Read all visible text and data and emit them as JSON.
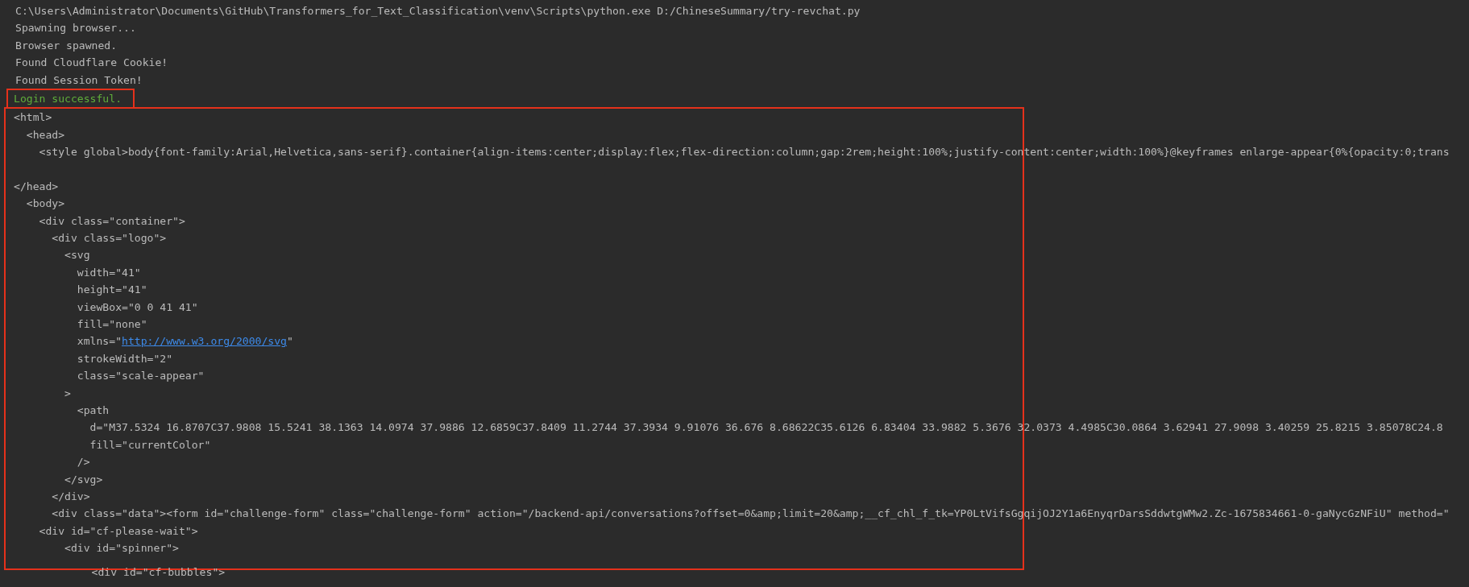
{
  "console": {
    "blocks": [
      {
        "kind": "plain",
        "lines": [
          {
            "kind": "plain",
            "text": "C:\\Users\\Administrator\\Documents\\GitHub\\Transformers_for_Text_Classification\\venv\\Scripts\\python.exe D:/ChineseSummary/try-revchat.py"
          },
          {
            "kind": "plain",
            "text": "Spawning browser..."
          },
          {
            "kind": "plain",
            "text": "Browser spawned."
          },
          {
            "kind": "plain",
            "text": "Found Cloudflare Cookie!"
          },
          {
            "kind": "plain",
            "text": "Found Session Token!"
          }
        ]
      },
      {
        "kind": "narrow",
        "lines": [
          {
            "kind": "success",
            "text": "Login successful."
          }
        ]
      },
      {
        "kind": "wide",
        "lines": [
          {
            "kind": "plain",
            "text": "<html>"
          },
          {
            "kind": "plain",
            "text": "  <head>"
          },
          {
            "kind": "plain",
            "text": "    <style global>body{font-family:Arial,Helvetica,sans-serif}.container{align-items:center;display:flex;flex-direction:column;gap:2rem;height:100%;justify-content:center;width:100%}@keyframes enlarge-appear{0%{opacity:0;trans"
          },
          {
            "kind": "blank"
          },
          {
            "kind": "plain",
            "text": "</head>"
          },
          {
            "kind": "plain",
            "text": "  <body>"
          },
          {
            "kind": "plain",
            "text": "    <div class=\"container\">"
          },
          {
            "kind": "plain",
            "text": "      <div class=\"logo\">"
          },
          {
            "kind": "plain",
            "text": "        <svg"
          },
          {
            "kind": "plain",
            "text": "          width=\"41\""
          },
          {
            "kind": "plain",
            "text": "          height=\"41\""
          },
          {
            "kind": "plain",
            "text": "          viewBox=\"0 0 41 41\""
          },
          {
            "kind": "plain",
            "text": "          fill=\"none\""
          },
          {
            "kind": "link",
            "before": "          xmlns=\"",
            "link": "http://www.w3.org/2000/svg",
            "after": "\""
          },
          {
            "kind": "plain",
            "text": "          strokeWidth=\"2\""
          },
          {
            "kind": "plain",
            "text": "          class=\"scale-appear\""
          },
          {
            "kind": "plain",
            "text": "        >"
          },
          {
            "kind": "plain",
            "text": "          <path"
          },
          {
            "kind": "plain",
            "text": "            d=\"M37.5324 16.8707C37.9808 15.5241 38.1363 14.0974 37.9886 12.6859C37.8409 11.2744 37.3934 9.91076 36.676 8.68622C35.6126 6.83404 33.9882 5.3676 32.0373 4.4985C30.0864 3.62941 27.9098 3.40259 25.8215 3.85078C24.8"
          },
          {
            "kind": "plain",
            "text": "            fill=\"currentColor\""
          },
          {
            "kind": "plain",
            "text": "          />"
          },
          {
            "kind": "plain",
            "text": "        </svg>"
          },
          {
            "kind": "plain",
            "text": "      </div>"
          },
          {
            "kind": "plain",
            "text": "      <div class=\"data\"><form id=\"challenge-form\" class=\"challenge-form\" action=\"/backend-api/conversations?offset=0&amp;limit=20&amp;__cf_chl_f_tk=YP0LtVifsGgqijOJ2Y1a6EnyqrDarsSddwtgWMw2.Zc-1675834661-0-gaNycGzNFiU\" method=\""
          },
          {
            "kind": "plain",
            "text": "    <div id=\"cf-please-wait\">"
          },
          {
            "kind": "plain",
            "text": "        <div id=\"spinner\">"
          }
        ]
      },
      {
        "kind": "plain",
        "lines": [
          {
            "kind": "plain",
            "text": "            <div id=\"cf-bubbles\">"
          }
        ]
      }
    ]
  }
}
